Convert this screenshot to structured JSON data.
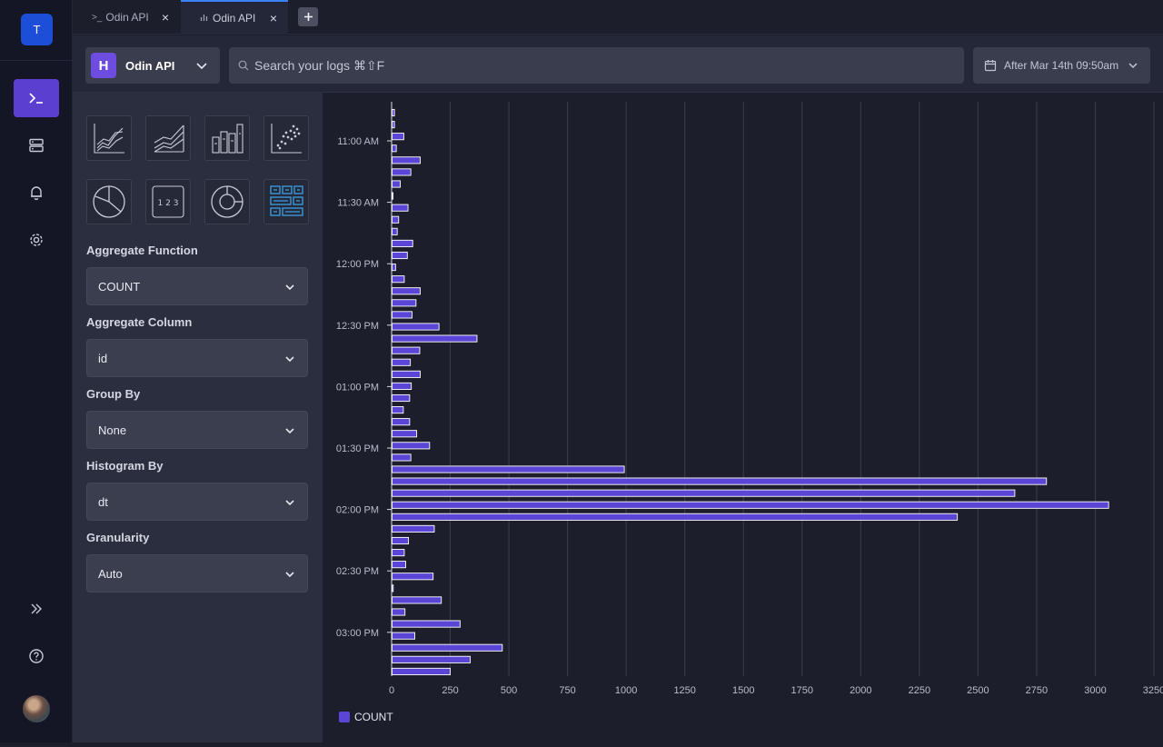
{
  "team": {
    "initial": "T"
  },
  "tabs": [
    {
      "label": "Odin API",
      "icon": "terminal-icon"
    },
    {
      "label": "Odin API",
      "icon": "chart-icon"
    }
  ],
  "tab_close": "×",
  "source": {
    "logo": "H",
    "name": "Odin API"
  },
  "search": {
    "placeholder": "Search your logs ⌘⇧F"
  },
  "date_range": {
    "label": "After Mar 14th 09:50am"
  },
  "viz_types": [
    "line-chart-icon",
    "area-chart-icon",
    "bar-chart-icon",
    "scatter-chart-icon",
    "pie-chart-icon",
    "number-icon",
    "donut-chart-icon",
    "table-icon"
  ],
  "number_glyph": "1 2 3",
  "fields": [
    {
      "label": "Aggregate Function",
      "value": "COUNT"
    },
    {
      "label": "Aggregate Column",
      "value": "id"
    },
    {
      "label": "Group By",
      "value": "None"
    },
    {
      "label": "Histogram By",
      "value": "dt"
    },
    {
      "label": "Granularity",
      "value": "Auto"
    }
  ],
  "colors": {
    "accent": "#5b3fd1",
    "bar": "#5b45d6",
    "bar_border": "#ffffff",
    "grid": "#3a3d4c"
  },
  "chart_data": {
    "type": "bar",
    "orientation": "horizontal",
    "series": [
      {
        "name": "COUNT",
        "values": [
          10,
          10,
          50,
          18,
          120,
          80,
          35,
          3,
          68,
          28,
          22,
          88,
          65,
          15,
          52,
          120,
          102,
          85,
          200,
          362,
          118,
          78,
          120,
          82,
          75,
          48,
          75,
          105,
          160,
          80,
          990,
          2790,
          2655,
          3055,
          2410,
          180,
          70,
          52,
          58,
          175,
          5,
          210,
          55,
          290,
          97,
          470,
          333,
          248
        ]
      }
    ],
    "y_tick_labels": [
      "11:00 AM",
      "11:30 AM",
      "12:00 PM",
      "12:30 PM",
      "01:00 PM",
      "01:30 PM",
      "02:00 PM",
      "02:30 PM",
      "03:00 PM"
    ],
    "x_ticks": [
      0,
      250,
      500,
      750,
      1000,
      1250,
      1500,
      1750,
      2000,
      2250,
      2500,
      2750,
      3000,
      3250
    ],
    "xlim": [
      0,
      3250
    ],
    "grid": true,
    "legend_position": "bottom-left"
  }
}
